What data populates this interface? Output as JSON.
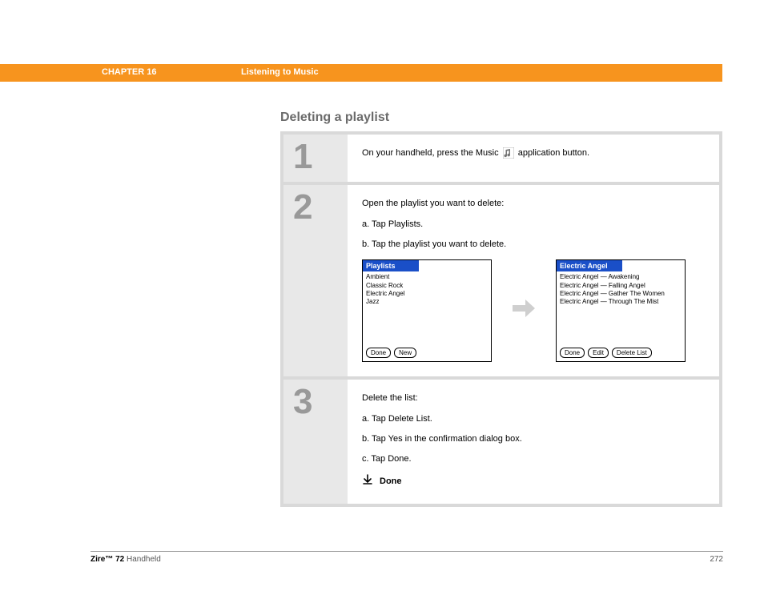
{
  "header": {
    "chapter": "CHAPTER 16",
    "title": "Listening to Music"
  },
  "section_title": "Deleting a playlist",
  "steps": {
    "s1": {
      "num": "1",
      "text_before": "On your handheld, press the Music ",
      "text_after": " application button."
    },
    "s2": {
      "num": "2",
      "intro": "Open the playlist you want to delete:",
      "a": "a.  Tap Playlists.",
      "b": "b.  Tap the playlist you want to delete.",
      "screen_left": {
        "title": "Playlists",
        "items": [
          "Ambient",
          "Classic Rock",
          "Electric Angel",
          "Jazz"
        ],
        "btns": [
          "Done",
          "New"
        ]
      },
      "screen_right": {
        "title": "Electric Angel",
        "items": [
          "Electric Angel — Awakening",
          "Electric Angel — Falling Angel",
          "Electric Angel — Gather The Women",
          "Electric Angel — Through The Mist"
        ],
        "btns": [
          "Done",
          "Edit",
          "Delete List"
        ]
      }
    },
    "s3": {
      "num": "3",
      "intro": "Delete the list:",
      "a": "a.  Tap Delete List.",
      "b": "b.  Tap Yes in the confirmation dialog box.",
      "c": "c.  Tap Done.",
      "done": "Done"
    }
  },
  "footer": {
    "product_bold": "Zire™ 72",
    "product_rest": " Handheld",
    "page": "272"
  }
}
